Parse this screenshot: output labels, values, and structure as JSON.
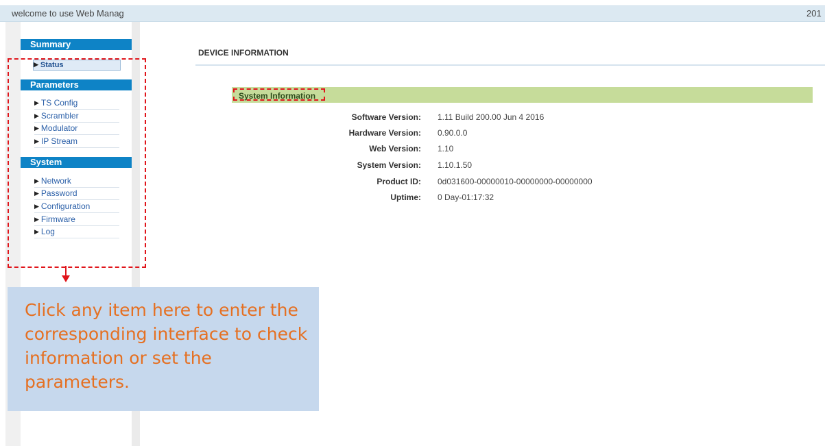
{
  "header": {
    "welcome_text": "welcome to use Web Manag",
    "year_text": "201"
  },
  "sidebar": {
    "sections": [
      {
        "title": "Summary",
        "items": [
          "Status"
        ]
      },
      {
        "title": "Parameters",
        "items": [
          "TS Config",
          "Scrambler",
          "Modulator",
          "IP Stream"
        ]
      },
      {
        "title": "System",
        "items": [
          "Network",
          "Password",
          "Configuration",
          "Firmware",
          "Log"
        ]
      }
    ],
    "active_item": "Status"
  },
  "main": {
    "page_title": "DEVICE INFORMATION",
    "section_title": "System Information",
    "rows": [
      {
        "label": "Software Version:",
        "value": "1.11 Build 200.00 Jun 4 2016"
      },
      {
        "label": "Hardware Version:",
        "value": "0.90.0.0"
      },
      {
        "label": "Web Version:",
        "value": "1.10"
      },
      {
        "label": "System Version:",
        "value": "1.10.1.50"
      },
      {
        "label": "Product ID:",
        "value": "0d031600-00000010-00000000-00000000"
      },
      {
        "label": "Uptime:",
        "value": "0 Day-01:17:32"
      }
    ]
  },
  "annotation": {
    "text": "Click any item here to enter the corresponding interface to check information or set the parameters."
  },
  "colors": {
    "section_header": "#0e83c6",
    "section_bar": "#c6dc9a",
    "annotation_red": "#e0151b",
    "callout_bg": "#c6d8ed",
    "callout_text": "#e57022"
  },
  "icons": {
    "menu_bullet": "triangle-right-icon"
  }
}
